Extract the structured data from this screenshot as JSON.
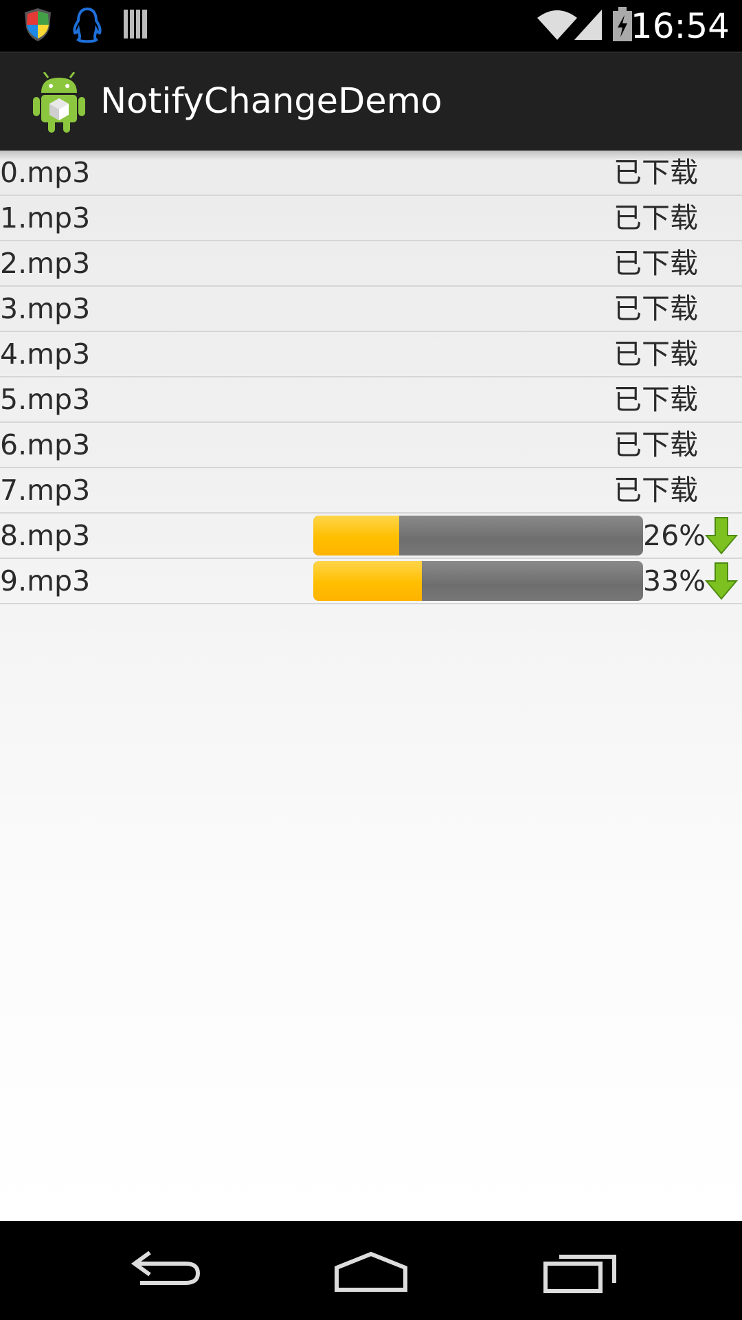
{
  "status_bar": {
    "time": "16:54",
    "left_icons": [
      "shield-icon",
      "qq-penguin-icon",
      "barcode-icon"
    ],
    "right_icons": [
      "wifi-icon",
      "signal-icon",
      "battery-charging-icon"
    ]
  },
  "action_bar": {
    "title": "NotifyChangeDemo",
    "icon": "android-app-icon"
  },
  "files": [
    {
      "name": "0.mp3",
      "status": "已下载"
    },
    {
      "name": "1.mp3",
      "status": "已下载"
    },
    {
      "name": "2.mp3",
      "status": "已下载"
    },
    {
      "name": "3.mp3",
      "status": "已下载"
    },
    {
      "name": "4.mp3",
      "status": "已下载"
    },
    {
      "name": "5.mp3",
      "status": "已下载"
    },
    {
      "name": "6.mp3",
      "status": "已下载"
    },
    {
      "name": "7.mp3",
      "status": "已下载"
    },
    {
      "name": "8.mp3",
      "progress": 26,
      "progress_label": "26%"
    },
    {
      "name": "9.mp3",
      "progress": 33,
      "progress_label": "33%"
    }
  ],
  "colors": {
    "progress_fill": "#ffbf00",
    "progress_track": "#767676",
    "download_arrow": "#7cc11f"
  },
  "nav_bar": {
    "buttons": [
      "back-icon",
      "home-icon",
      "recents-icon"
    ]
  }
}
